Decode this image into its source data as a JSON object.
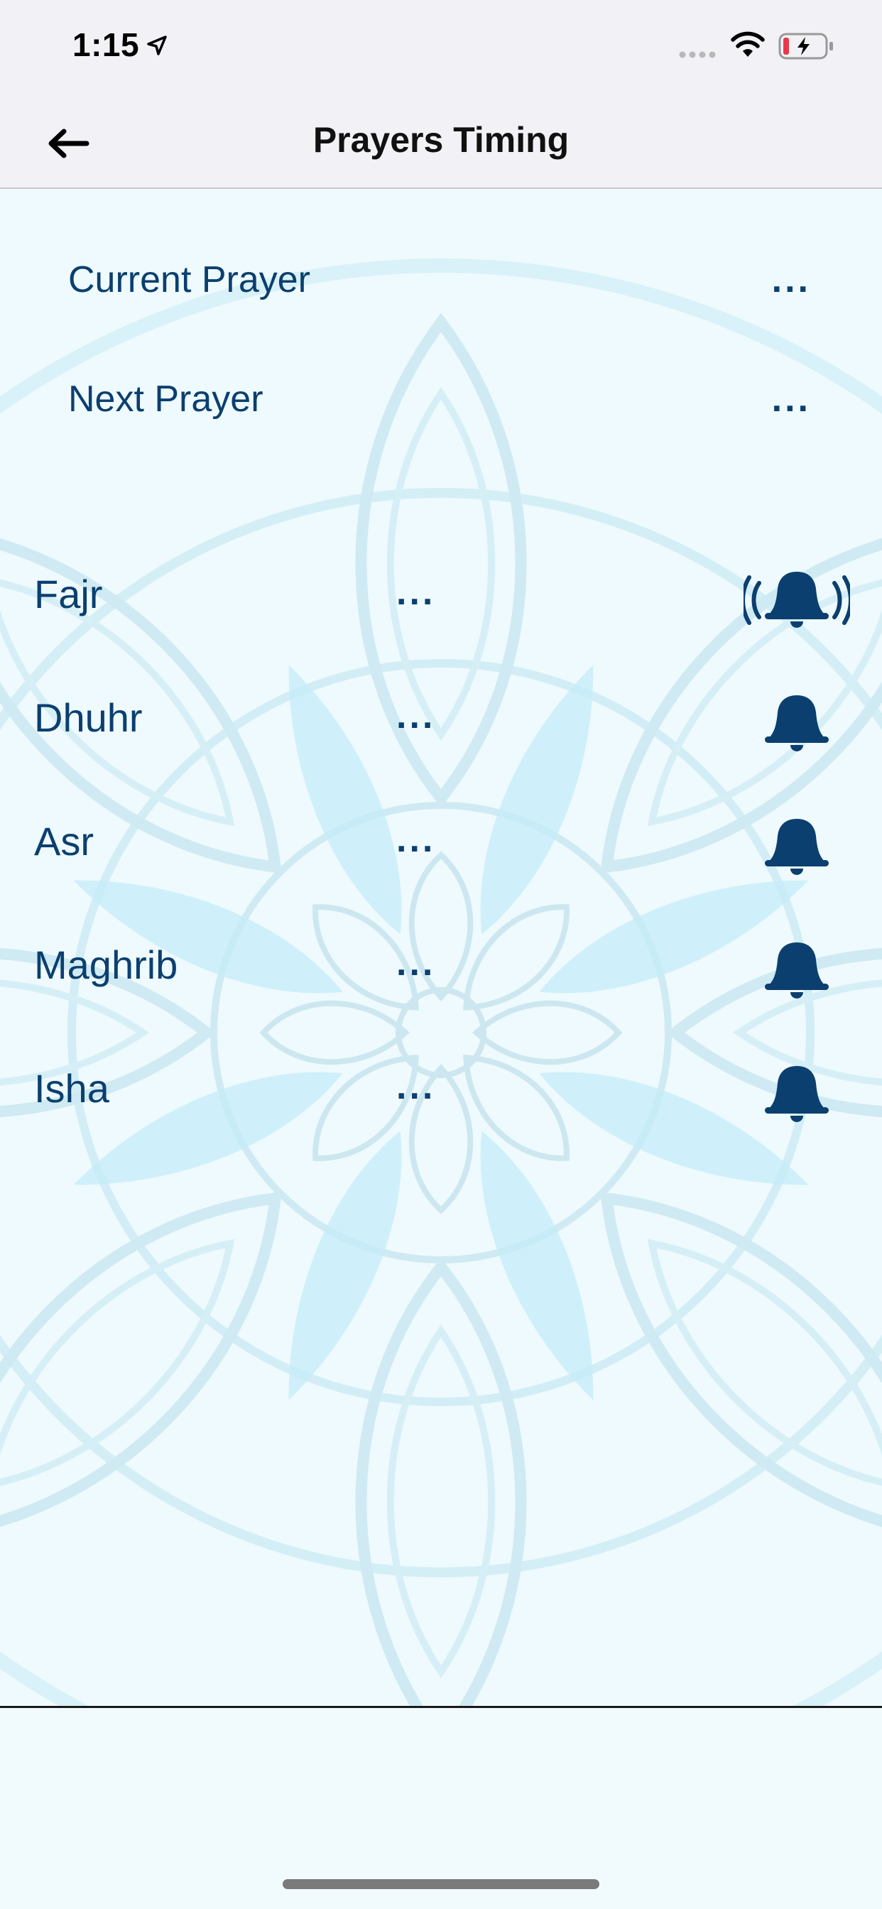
{
  "status_bar": {
    "time": "1:15"
  },
  "nav": {
    "title": "Prayers Timing"
  },
  "summary": {
    "current_label": "Current Prayer",
    "current_value": "...",
    "next_label": "Next Prayer",
    "next_value": "..."
  },
  "prayers": [
    {
      "name": "Fajr",
      "time": "...",
      "alert_icon": "bell-ringing-icon"
    },
    {
      "name": "Dhuhr",
      "time": "...",
      "alert_icon": "bell-icon"
    },
    {
      "name": "Asr",
      "time": "...",
      "alert_icon": "bell-icon"
    },
    {
      "name": "Maghrib",
      "time": "...",
      "alert_icon": "bell-icon"
    },
    {
      "name": "Isha",
      "time": "...",
      "alert_icon": "bell-icon"
    }
  ],
  "colors": {
    "primary": "#0b3f6f",
    "background": "#eefafd",
    "mandala": "#b9e8f5"
  }
}
